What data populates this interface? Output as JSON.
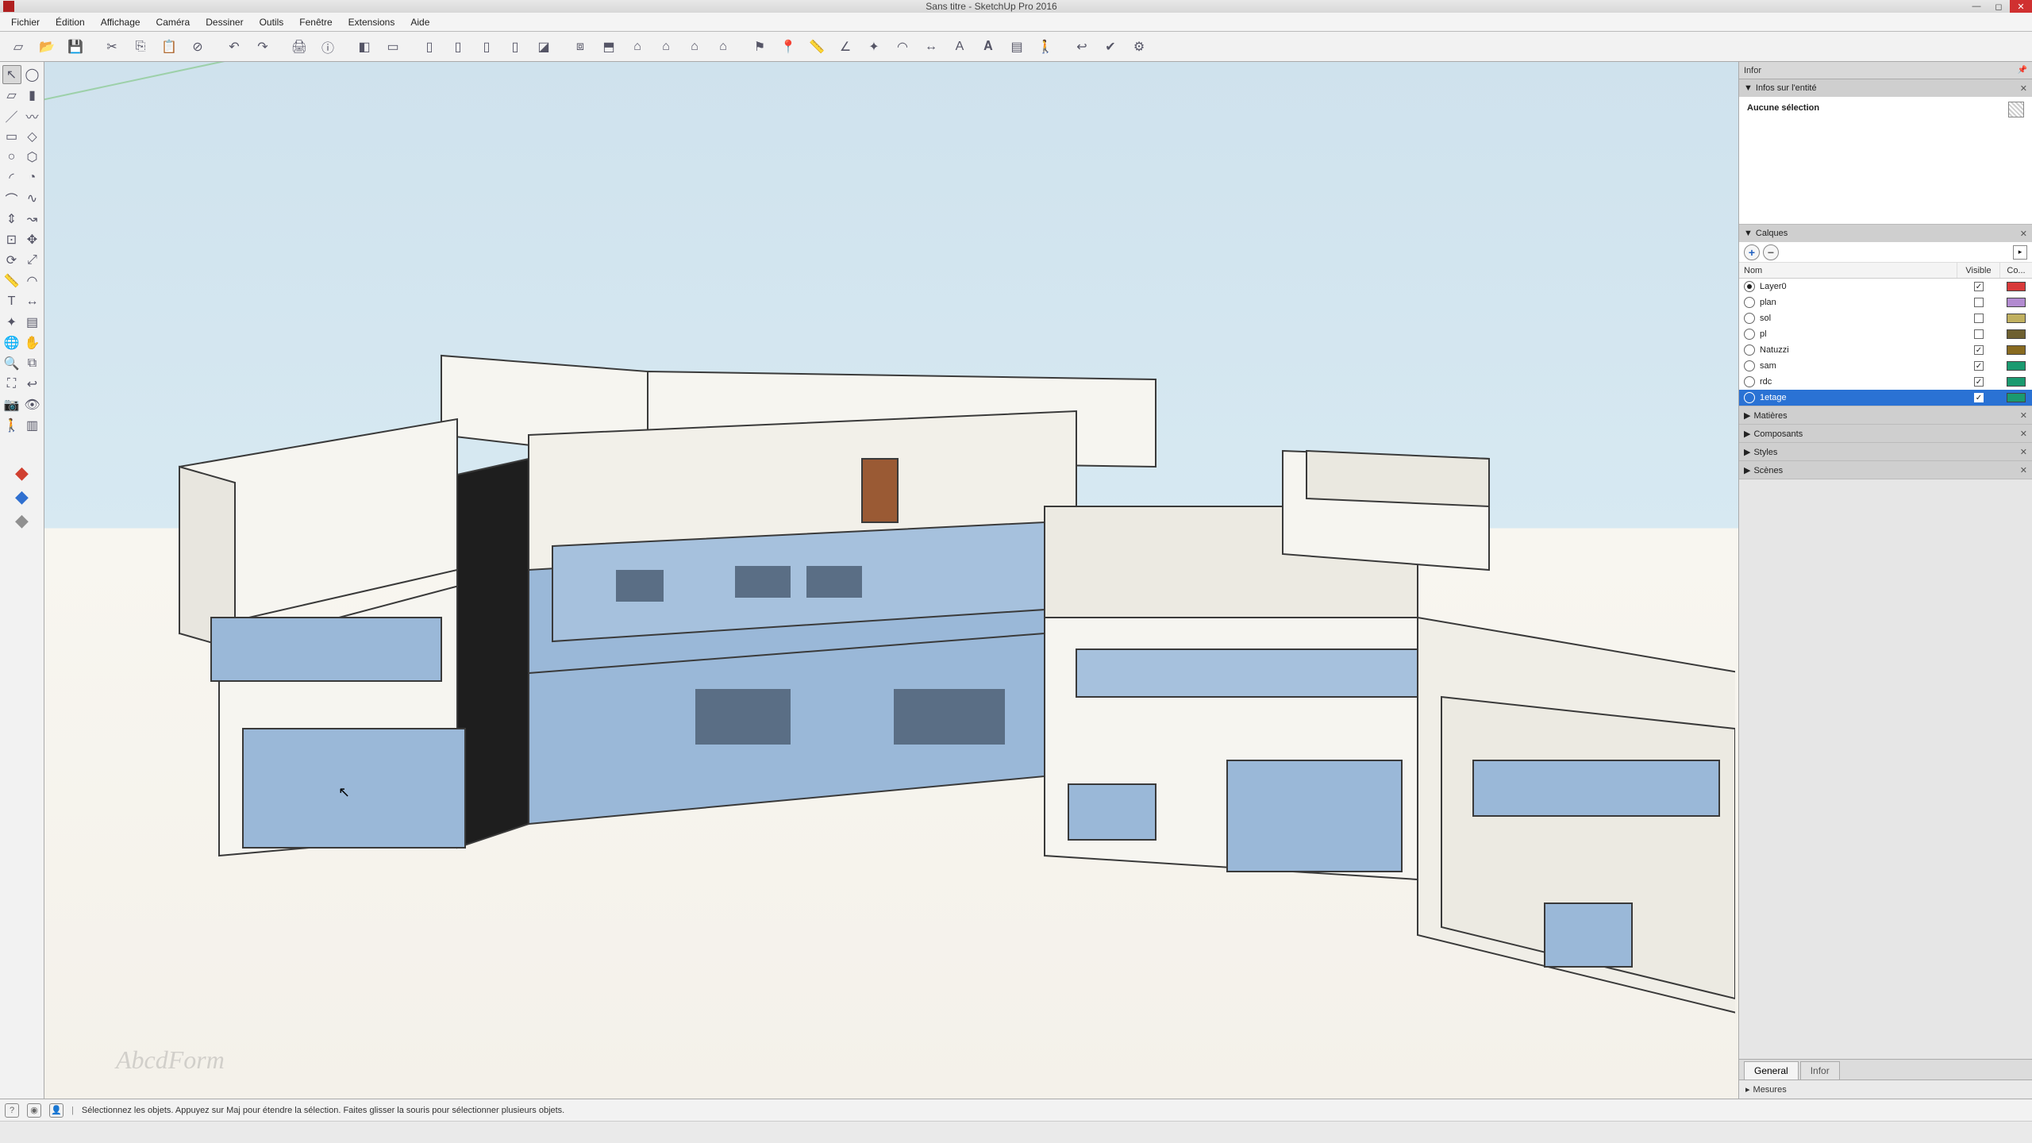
{
  "title": "Sans titre - SketchUp Pro 2016",
  "menu": [
    "Fichier",
    "Édition",
    "Affichage",
    "Caméra",
    "Dessiner",
    "Outils",
    "Fenêtre",
    "Extensions",
    "Aide"
  ],
  "toolbar_top": [
    "new-file",
    "open-file",
    "save-file",
    "sep",
    "cut",
    "copy",
    "paste",
    "delete",
    "sep",
    "undo",
    "redo",
    "sep",
    "print",
    "model-info",
    "sep",
    "iso-view",
    "top-view",
    "sep",
    "front-view",
    "back-view",
    "left-view",
    "right-view",
    "perspective",
    "sep",
    "components",
    "section",
    "house1",
    "house2",
    "house3",
    "house4",
    "sep",
    "tag",
    "marker",
    "tape",
    "angle",
    "axes",
    "protractor",
    "dim",
    "text",
    "3dtext",
    "section-plane",
    "walk",
    "sep",
    "prev-view",
    "validate",
    "plugin"
  ],
  "left_tools": [
    [
      "select",
      "lasso"
    ],
    [
      "eraser",
      "paint"
    ],
    [
      "line",
      "freehand"
    ],
    [
      "rectangle",
      "rot-rect"
    ],
    [
      "circle",
      "polygon"
    ],
    [
      "arc",
      "pie"
    ],
    [
      "arc2",
      "bezier"
    ],
    [
      "pushpull",
      "follow"
    ],
    [
      "offset",
      "move"
    ],
    [
      "rotate",
      "scale"
    ],
    [
      "tape",
      "protractor2"
    ],
    [
      "text-tool",
      "dim-tool"
    ],
    [
      "axes-tool",
      "section-tool"
    ],
    [
      "orbit",
      "pan"
    ],
    [
      "zoom",
      "zoom-window"
    ],
    [
      "zoom-ext",
      "prev"
    ],
    [
      "position-cam",
      "look"
    ],
    [
      "walk-tool",
      "section2"
    ]
  ],
  "view_cubes": [
    "iso-red",
    "iso-blue",
    "iso-grey"
  ],
  "tray_title": "Infor",
  "panels": {
    "entity": {
      "title": "Infos sur l'entité",
      "body": "Aucune sélection"
    },
    "layers": {
      "title": "Calques",
      "columns": {
        "name": "Nom",
        "visible": "Visible",
        "color": "Co..."
      },
      "rows": [
        {
          "name": "Layer0",
          "active": true,
          "visible": true,
          "color": "#d83a3a"
        },
        {
          "name": "plan",
          "active": false,
          "visible": false,
          "color": "#b28bd0"
        },
        {
          "name": "sol",
          "active": false,
          "visible": false,
          "color": "#c0b060"
        },
        {
          "name": "pl",
          "active": false,
          "visible": false,
          "color": "#6e6030"
        },
        {
          "name": "Natuzzi",
          "active": false,
          "visible": true,
          "color": "#886a20"
        },
        {
          "name": "sam",
          "active": false,
          "visible": true,
          "color": "#1a9a70"
        },
        {
          "name": "rdc",
          "active": false,
          "visible": true,
          "color": "#1a9a70"
        },
        {
          "name": "1etage",
          "active": false,
          "visible": true,
          "color": "#1a9a70",
          "selected": true
        }
      ]
    },
    "collapsed": [
      "Matières",
      "Composants",
      "Styles",
      "Scènes"
    ]
  },
  "tray_tabs": [
    "General",
    "Infor"
  ],
  "measures_label": "Mesures",
  "status_hint": "Sélectionnez les objets. Appuyez sur Maj pour étendre la sélection. Faites glisser la souris pour sélectionner plusieurs objets.",
  "watermark": "AbcdForm"
}
